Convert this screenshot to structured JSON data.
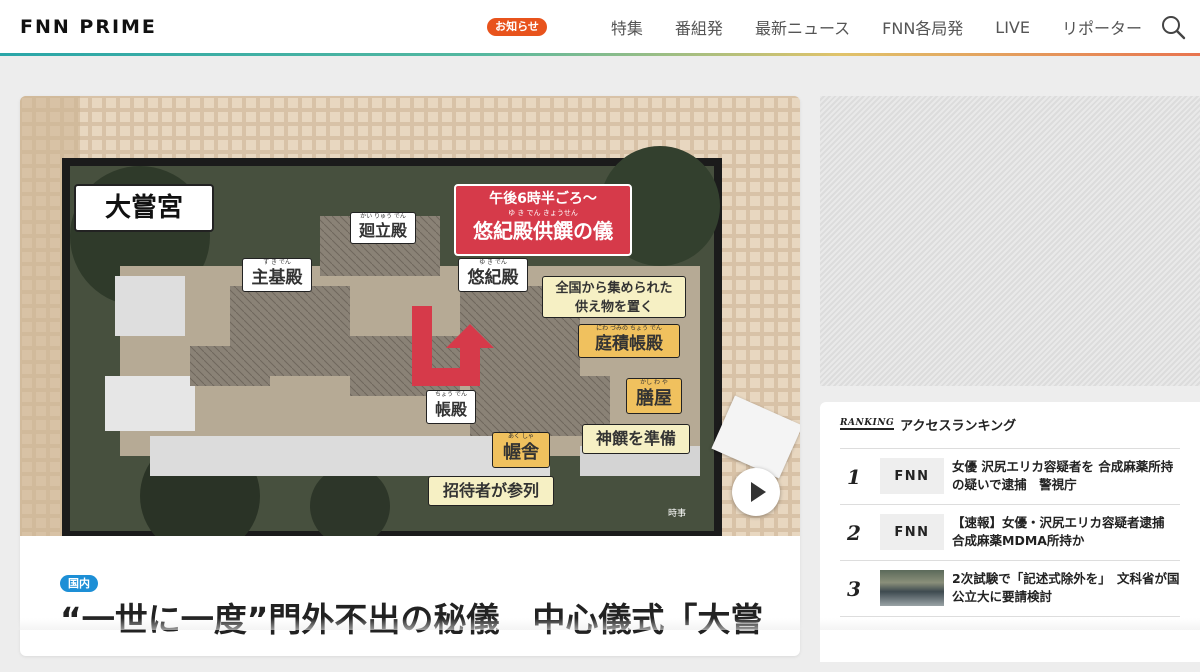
{
  "header": {
    "logo_text": "FNN PRIME",
    "badge": "お知らせ",
    "nav": [
      "特集",
      "番組発",
      "最新ニュース",
      "FNN各局発",
      "LIVE",
      "リポーター"
    ],
    "search_icon": "search-icon"
  },
  "article": {
    "category": "国内",
    "headline": "“一世に一度”門外不出の秘儀　中心儀式「大嘗",
    "image": {
      "title_board": "大嘗宮",
      "time_label": "午後6時半ごろ～",
      "ceremony": "悠紀殿供饌の儀",
      "ceremony_ruby": "ゆ き でん きょうせん",
      "labels": {
        "kairyuden": "廻立殿",
        "kairyuden_ruby": "かい りゅう でん",
        "sukiden": "主基殿",
        "sukiden_ruby": "す き でん",
        "yukiden": "悠紀殿",
        "yukiden_ruby": "ゆ き でん",
        "offering_note_1": "全国から集められた",
        "offering_note_2": "供え物を置く",
        "niwazumi": "庭積帳殿",
        "niwazumi_ruby": "にわ づみの ちょう でん",
        "kashiwaya": "膳屋",
        "kashiwaya_ruby": "かし わ や",
        "shinsen": "神饌を準備",
        "chouden": "帳殿",
        "chouden_ruby": "ちょう でん",
        "akusha": "幄舎",
        "akusha_ruby": "あく しゃ",
        "guests": "招待者が参列",
        "credit": "時事"
      }
    },
    "play_icon": "play-icon"
  },
  "ranking": {
    "mark": "RANKING",
    "title": "アクセスランキング",
    "items": [
      {
        "rank": "1",
        "thumb": "FNN",
        "text": "女優 沢尻エリカ容疑者を 合成麻薬所持の疑いで逮捕　警視庁"
      },
      {
        "rank": "2",
        "thumb": "FNN",
        "text": "【速報】女優・沢尻エリカ容疑者逮捕　合成麻薬MDMA所持か"
      },
      {
        "rank": "3",
        "thumb": "",
        "text": "2次試験で「記述式除外を」　文科省が国公立大に要請検討"
      }
    ]
  },
  "colors": {
    "accent_badge": "#e8531c",
    "category_tag": "#1d8fd6",
    "ceremony_red": "#d63a4a"
  }
}
